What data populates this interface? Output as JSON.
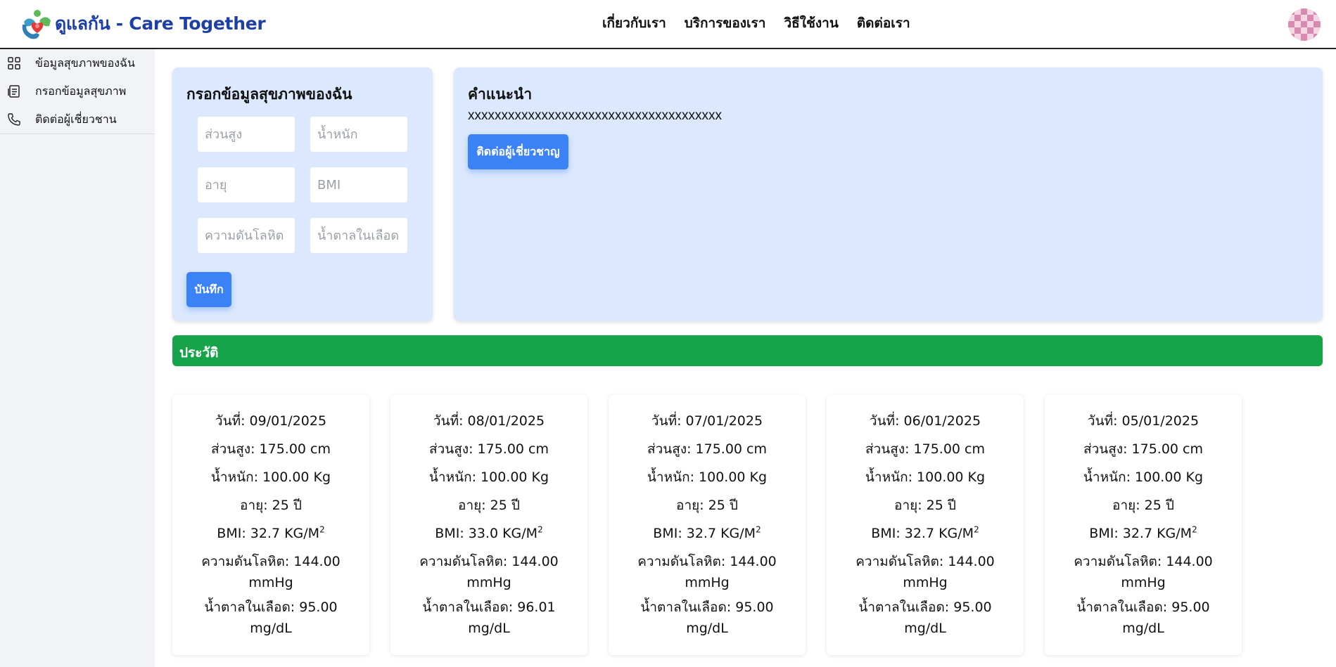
{
  "header": {
    "brand": "ดูแลกัน - Care Together",
    "nav": [
      "เกี่ยวกับเรา",
      "บริการของเรา",
      "วิธีใช้งาน",
      "ติดต่อเรา"
    ]
  },
  "sidebar": {
    "items": [
      {
        "label": "ข้อมูลสุขภาพของฉัน",
        "icon": "grid-icon"
      },
      {
        "label": "กรอกข้อมูลสุขภาพ",
        "icon": "form-icon"
      },
      {
        "label": "ติดต่อผู้เชี่ยวชาน",
        "icon": "phone-icon"
      }
    ]
  },
  "form": {
    "title": "กรอกข้อมูลสุขภาพของฉัน",
    "fields": {
      "height": "ส่วนสูง",
      "weight": "น้ำหนัก",
      "age": "อายุ",
      "bmi": "BMI",
      "pressure": "ความดันโลหิต",
      "sugar": "น้ำตาลในเลือด"
    },
    "save_label": "บันทึก"
  },
  "advice": {
    "title": "คำแนะนำ",
    "text": "xxxxxxxxxxxxxxxxxxxxxxxxxxxxxxxxxxxxxx",
    "contact_label": "ติดต่อผู้เชี่ยวชาญ"
  },
  "history": {
    "title": "ประวัติ",
    "records": [
      {
        "date": "วันที่: 09/01/2025",
        "height": "ส่วนสูง: 175.00 cm",
        "weight": "น้ำหนัก: 100.00 Kg",
        "age": "อายุ: 25 ปี",
        "bmi": "BMI: 32.7 KG/M",
        "pressure": "ความดันโลหิต: 144.00 mmHg",
        "sugar": "น้ำตาลในเลือด: 95.00 mg/dL"
      },
      {
        "date": "วันที่: 08/01/2025",
        "height": "ส่วนสูง: 175.00 cm",
        "weight": "น้ำหนัก: 100.00 Kg",
        "age": "อายุ: 25 ปี",
        "bmi": "BMI: 33.0 KG/M",
        "pressure": "ความดันโลหิต: 144.00 mmHg",
        "sugar": "น้ำตาลในเลือด: 96.01 mg/dL"
      },
      {
        "date": "วันที่: 07/01/2025",
        "height": "ส่วนสูง: 175.00 cm",
        "weight": "น้ำหนัก: 100.00 Kg",
        "age": "อายุ: 25 ปี",
        "bmi": "BMI: 32.7 KG/M",
        "pressure": "ความดันโลหิต: 144.00 mmHg",
        "sugar": "น้ำตาลในเลือด: 95.00 mg/dL"
      },
      {
        "date": "วันที่: 06/01/2025",
        "height": "ส่วนสูง: 175.00 cm",
        "weight": "น้ำหนัก: 100.00 Kg",
        "age": "อายุ: 25 ปี",
        "bmi": "BMI: 32.7 KG/M",
        "pressure": "ความดันโลหิต: 144.00 mmHg",
        "sugar": "น้ำตาลในเลือด: 95.00 mg/dL"
      },
      {
        "date": "วันที่: 05/01/2025",
        "height": "ส่วนสูง: 175.00 cm",
        "weight": "น้ำหนัก: 100.00 Kg",
        "age": "อายุ: 25 ปี",
        "bmi": "BMI: 32.7 KG/M",
        "pressure": "ความดันโลหิต: 144.00 mmHg",
        "sugar": "น้ำตาลในเลือด: 95.00 mg/dL"
      }
    ],
    "bmi_exponent": "2"
  },
  "colors": {
    "brand": "#1e3fa6",
    "card_bg": "#dbe8fd",
    "button": "#3b82f6",
    "history_bar": "#16a34a"
  }
}
